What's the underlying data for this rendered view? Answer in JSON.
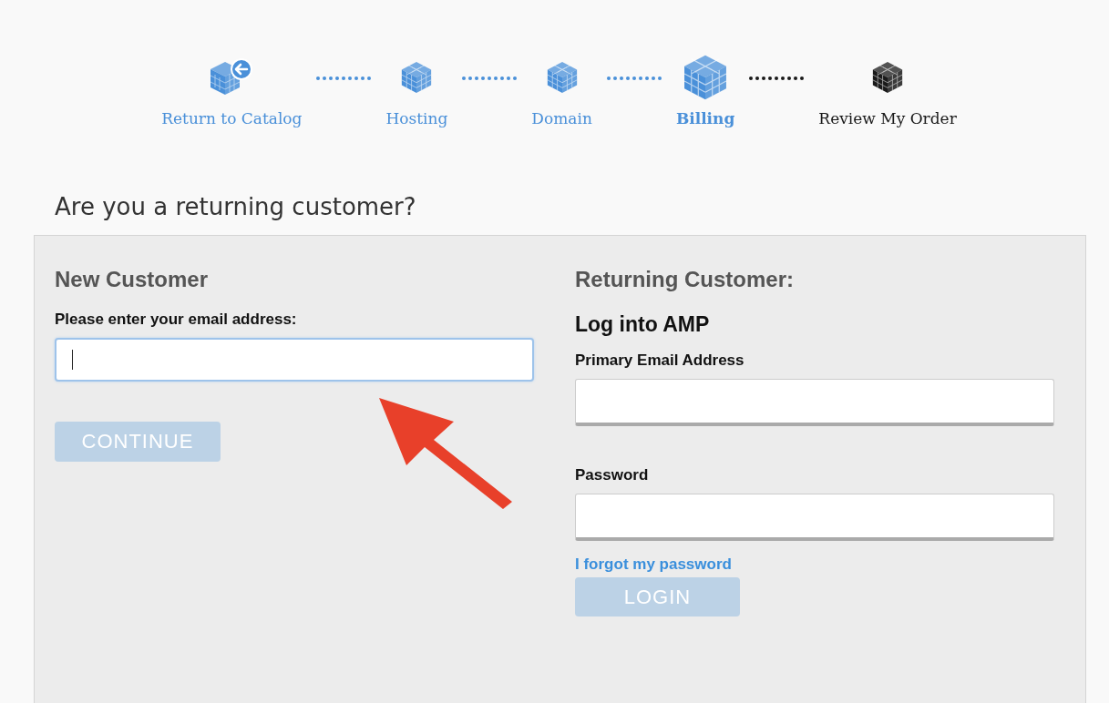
{
  "steps": [
    {
      "label": "Return to Catalog",
      "kind": "return",
      "reached": true,
      "selected": false
    },
    {
      "label": "Hosting",
      "kind": "step",
      "reached": true,
      "selected": false
    },
    {
      "label": "Domain",
      "kind": "step",
      "reached": true,
      "selected": false
    },
    {
      "label": "Billing",
      "kind": "step",
      "reached": true,
      "selected": true
    },
    {
      "label": "Review My Order",
      "kind": "step",
      "reached": false,
      "selected": false
    }
  ],
  "heading": "Are you a returning customer?",
  "new_customer": {
    "title": "New Customer",
    "email_label": "Please enter your email address:",
    "email_focused": true,
    "continue_button": {
      "label": "CONTINUE",
      "disabled": true
    }
  },
  "returning_customer": {
    "title": "Returning Customer:",
    "subtitle": "Log into AMP",
    "email_label": "Primary Email Address",
    "password_label": "Password",
    "forgot_link": "I forgot my password",
    "login_button": {
      "label": "LOGIN",
      "disabled": true
    }
  },
  "annotation": {
    "kind": "arrow"
  }
}
